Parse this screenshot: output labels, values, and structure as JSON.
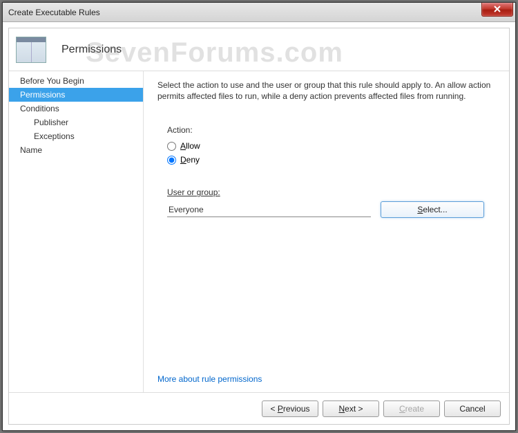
{
  "window": {
    "title": "Create Executable Rules"
  },
  "header": {
    "title": "Permissions"
  },
  "watermark": "SevenForums.com",
  "sidebar": {
    "items": [
      {
        "label": "Before You Begin"
      },
      {
        "label": "Permissions"
      },
      {
        "label": "Conditions"
      },
      {
        "label": "Publisher"
      },
      {
        "label": "Exceptions"
      },
      {
        "label": "Name"
      }
    ]
  },
  "content": {
    "description": "Select the action to use and the user or group that this rule should apply to. An allow action permits affected files to run, while a deny action prevents affected files from running.",
    "action_label": "Action:",
    "allow_label": "Allow",
    "deny_label": "Deny",
    "selected_action": "deny",
    "user_group_label": "User or group:",
    "user_group_value": "Everyone",
    "select_button": "Select...",
    "help_link": "More about rule permissions"
  },
  "footer": {
    "previous": "< Previous",
    "next": "Next >",
    "create": "Create",
    "cancel": "Cancel"
  }
}
